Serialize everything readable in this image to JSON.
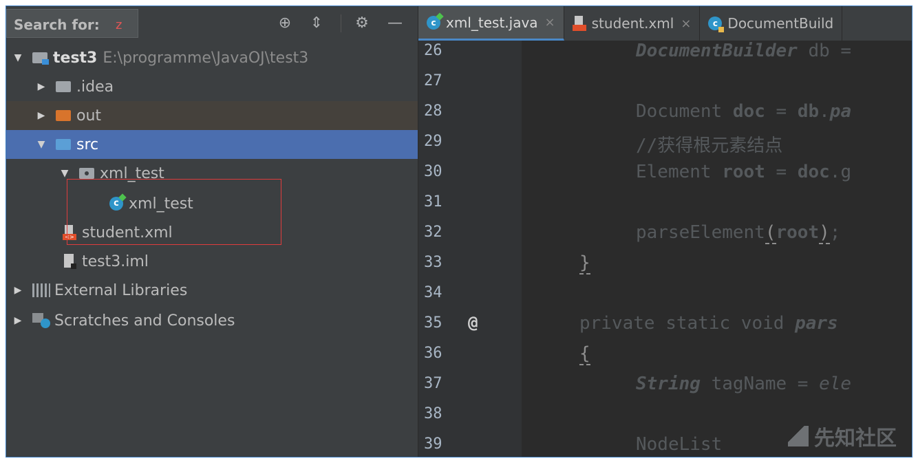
{
  "search": {
    "label": "Search for:",
    "query": "z"
  },
  "toolbar": {
    "locate_icon": "⊕",
    "collapse_icon": "⇕",
    "settings_icon": "⚙",
    "hide_icon": "—"
  },
  "tree": [
    {
      "label": "test3",
      "path": "E:\\programme\\JavaOJ\\test3"
    },
    {
      "label": ".idea"
    },
    {
      "label": "out"
    },
    {
      "label": "src"
    },
    {
      "label": "xml_test"
    },
    {
      "label": "xml_test"
    },
    {
      "label": "student.xml"
    },
    {
      "label": "test3.iml"
    },
    {
      "label": "External Libraries"
    },
    {
      "label": "Scratches and Consoles"
    }
  ],
  "tabs": [
    {
      "label": "xml_test.java",
      "close": "×"
    },
    {
      "label": "student.xml",
      "close": "×"
    },
    {
      "label": "DocumentBuild"
    }
  ],
  "editor": {
    "line_numbers": [
      "26",
      "27",
      "28",
      "29",
      "30",
      "31",
      "32",
      "33",
      "34",
      "35",
      "36",
      "37",
      "38",
      "39"
    ],
    "annotation_marker": "@",
    "code": {
      "l26_type": "DocumentBuilder",
      "l26_rest": " db =",
      "l28_a": "Document ",
      "l28_b": "doc",
      "l28_c": " = ",
      "l28_d": "db",
      "l28_e": ".",
      "l28_f": "pa",
      "l29": "//获得根元素结点",
      "l30_a": "Element ",
      "l30_b": "root",
      "l30_c": " = ",
      "l30_d": "doc",
      "l30_e": ".g",
      "l32_a": "parseElement",
      "l32_b": "(",
      "l32_c": "root",
      "l32_d": ")",
      "l32_e": ";",
      "l33": "}",
      "l35_a": "private static void ",
      "l35_b": "pars",
      "l36": "{",
      "l37_a": "String",
      "l37_b": " tagName = ",
      "l37_c": "ele",
      "l39": "NodeList"
    }
  },
  "watermark": "先知社区",
  "colors": {
    "selection": "#4b6eaf",
    "highlight_box": "#e03c3c",
    "tab_accent": "#4a88c7"
  }
}
